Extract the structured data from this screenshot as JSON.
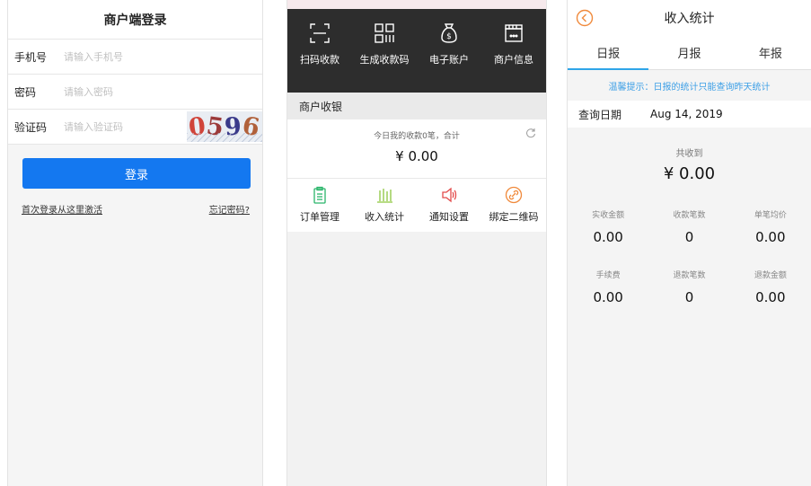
{
  "login": {
    "title": "商户端登录",
    "phone_label": "手机号",
    "phone_placeholder": "请输入手机号",
    "password_label": "密码",
    "password_placeholder": "请输入密码",
    "captcha_label": "验证码",
    "captcha_placeholder": "请输入验证码",
    "captcha_digits": [
      "0",
      "5",
      "9",
      "6"
    ],
    "login_button": "登录",
    "first_login_link": "首次登录从这里激活",
    "forgot_link": "忘记密码?"
  },
  "home": {
    "quick_actions": [
      {
        "label": "扫码收款",
        "icon": "scan-icon"
      },
      {
        "label": "生成收款码",
        "icon": "qrcode-icon"
      },
      {
        "label": "电子账户",
        "icon": "money-bag-icon"
      },
      {
        "label": "商户信息",
        "icon": "shop-icon"
      }
    ],
    "section_title": "商户收银",
    "summary_text": "今日我的收款0笔，合计",
    "summary_amount": "¥ 0.00",
    "menu": [
      {
        "label": "订单管理",
        "icon": "clipboard-icon",
        "color": "#29b56a"
      },
      {
        "label": "收入统计",
        "icon": "bar-chart-icon",
        "color": "#8dc63f"
      },
      {
        "label": "通知设置",
        "icon": "speaker-icon",
        "color": "#e34b4b"
      },
      {
        "label": "绑定二维码",
        "icon": "link-icon",
        "color": "#f08a3c"
      }
    ]
  },
  "stats": {
    "title": "收入统计",
    "tabs": [
      "日报",
      "月报",
      "年报"
    ],
    "active_tab": 0,
    "tip": "温馨提示：日报的统计只能查询昨天统计",
    "date_label": "查询日期",
    "date_value": "Aug 14, 2019",
    "total_label": "共收到",
    "total_value": "¥ 0.00",
    "row1": [
      {
        "label": "实收金额",
        "value": "0.00"
      },
      {
        "label": "收款笔数",
        "value": "0"
      },
      {
        "label": "单笔均价",
        "value": "0.00"
      }
    ],
    "row2": [
      {
        "label": "手续费",
        "value": "0.00"
      },
      {
        "label": "退款笔数",
        "value": "0"
      },
      {
        "label": "退款金额",
        "value": "0.00"
      }
    ],
    "accent_color": "#2fa5e8",
    "back_color": "#f08a3c"
  }
}
